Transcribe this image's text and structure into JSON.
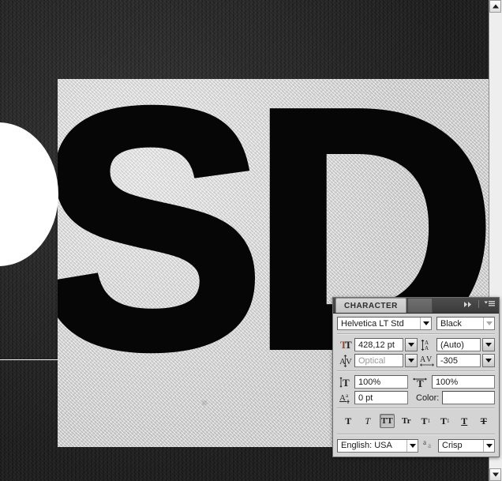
{
  "document": {
    "canvas_text": "SD",
    "glyph_left": "S",
    "glyph_right": "D",
    "background_color": "#2a2a2a",
    "paper_color": "#d8d8d8",
    "ink_color": "#060606"
  },
  "scrollbar": {
    "up_icon": "scroll-up-arrow-icon",
    "down_icon": "scroll-down-arrow-icon"
  },
  "character_panel": {
    "tab_label": "CHARACTER",
    "collapse_icon": "double-chevron-right-icon",
    "menu_icon": "panel-menu-icon",
    "font_family": {
      "icon": "font-family-field",
      "value": "Helvetica LT Std",
      "placeholder": "Font family"
    },
    "font_style": {
      "value": "Black",
      "placeholder": "Font style",
      "disabled": true
    },
    "font_size": {
      "icon": "font-size-icon",
      "icon_glyph": "T",
      "value": "428,12 pt",
      "placeholder": "Size"
    },
    "leading": {
      "icon": "leading-icon",
      "icon_glyph": "A",
      "value": "(Auto)",
      "placeholder": "Leading"
    },
    "kerning": {
      "icon": "kerning-icon",
      "icon_glyph": "AV",
      "value": "Optical",
      "placeholder": "Kerning",
      "disabled": true
    },
    "tracking": {
      "icon": "tracking-icon",
      "icon_glyph": "AV",
      "value": "-305",
      "placeholder": "Tracking"
    },
    "vertical_scale": {
      "icon": "vertical-scale-icon",
      "value": "100%",
      "placeholder": "Vertical scale"
    },
    "horizontal_scale": {
      "icon": "horizontal-scale-icon",
      "value": "100%",
      "placeholder": "Horizontal scale"
    },
    "baseline_shift": {
      "icon": "baseline-shift-icon",
      "value": "0 pt",
      "placeholder": "Baseline shift"
    },
    "color": {
      "label": "Color:",
      "swatch_color": "#ffffff"
    },
    "style_buttons": [
      {
        "name": "faux-bold-button",
        "glyph": "T",
        "style": "bold",
        "active": false
      },
      {
        "name": "faux-italic-button",
        "glyph": "T",
        "style": "italic",
        "active": false
      },
      {
        "name": "all-caps-button",
        "glyph": "TT",
        "style": "caps",
        "active": true
      },
      {
        "name": "small-caps-button",
        "glyph": "Tr",
        "style": "smallcaps",
        "active": false
      },
      {
        "name": "superscript-button",
        "glyph": "T",
        "style": "superscript",
        "active": false
      },
      {
        "name": "subscript-button",
        "glyph": "T",
        "style": "subscript",
        "active": false
      },
      {
        "name": "underline-button",
        "glyph": "T",
        "style": "underline",
        "active": false
      },
      {
        "name": "strikethrough-button",
        "glyph": "T",
        "style": "strike",
        "active": false
      }
    ],
    "language": {
      "value": "English: USA",
      "placeholder": "Language"
    },
    "anti_aliasing": {
      "icon": "anti-alias-icon",
      "icon_glyph": "aa",
      "value": "Crisp",
      "placeholder": "Anti-aliasing method"
    }
  }
}
